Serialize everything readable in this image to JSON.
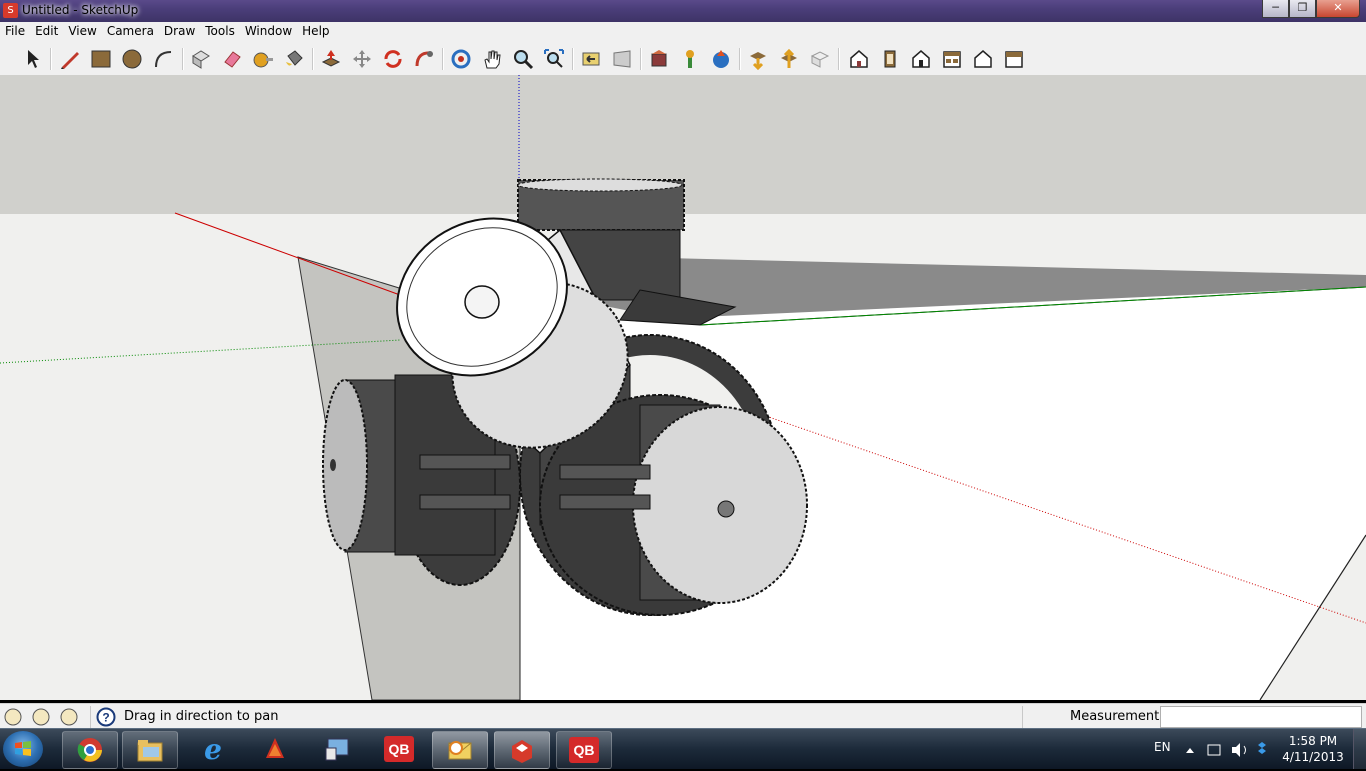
{
  "window": {
    "title": "Untitled - SketchUp",
    "min_label": "─",
    "max_label": "❐",
    "close_label": "✕"
  },
  "menu": {
    "file": "File",
    "edit": "Edit",
    "view": "View",
    "camera": "Camera",
    "draw": "Draw",
    "tools": "Tools",
    "window": "Window",
    "help": "Help"
  },
  "status": {
    "hint": "Drag in direction to pan",
    "measurements_label": "Measurements",
    "measurements_value": ""
  },
  "taskbar": {
    "qb_label": "QB",
    "lang": "EN",
    "time": "1:58 PM",
    "date": "4/11/2013"
  },
  "colors": {
    "axis_red": "#cc0000",
    "axis_green": "#008800",
    "axis_blue": "#0000cc",
    "sky": "#d0d0cc",
    "ground": "#f4f4f2"
  }
}
